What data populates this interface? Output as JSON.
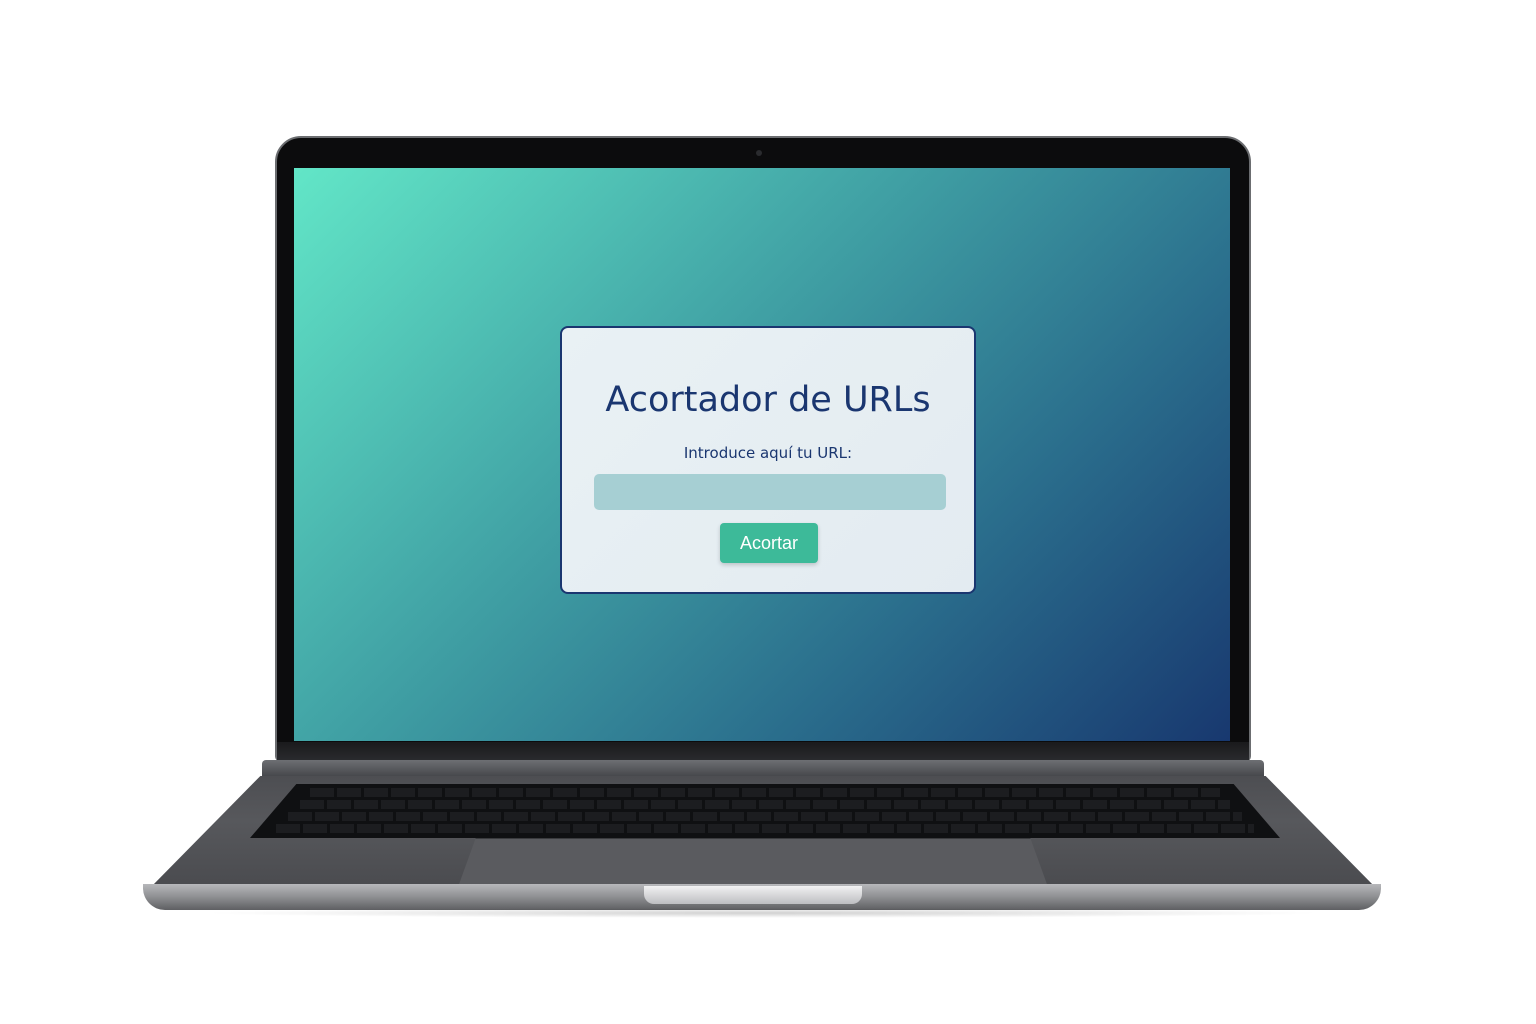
{
  "app": {
    "title": "Acortador de URLs",
    "input_label": "Introduce aquí tu URL:",
    "input_value": "",
    "input_placeholder": "",
    "submit_label": "Acortar"
  },
  "colors": {
    "accent": "#1a3670",
    "button": "#3dba99",
    "input_bg": "#a6cfd3",
    "gradient_start": "#62e6c7",
    "gradient_end": "#18386f"
  },
  "icons": [
    "laptop-frame",
    "webcam-icon"
  ]
}
